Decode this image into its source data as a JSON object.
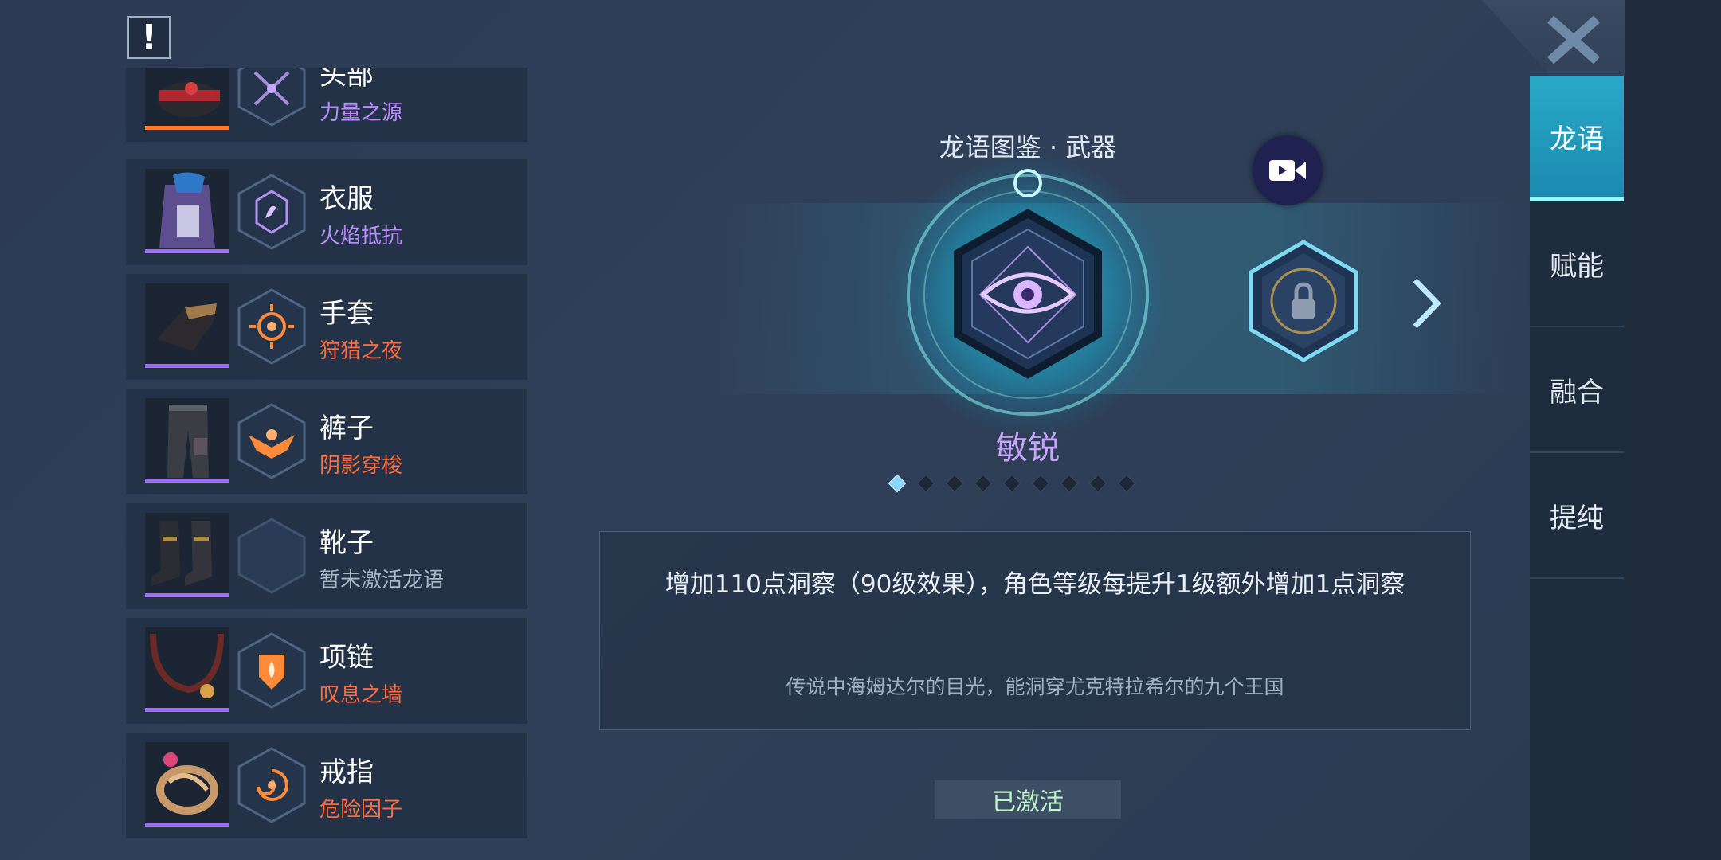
{
  "header": {
    "alert_icon": "!"
  },
  "equipment": [
    {
      "name": "头部",
      "sub": "力量之源",
      "sub_color": "#b98cff",
      "bar_color": "#ff7a2a",
      "icon": "crossed-swords-icon"
    },
    {
      "name": "衣服",
      "sub": "火焰抵抗",
      "sub_color": "#b98cff",
      "bar_color": "#9d6cff",
      "icon": "flame-sigil-icon"
    },
    {
      "name": "手套",
      "sub": "狩猎之夜",
      "sub_color": "#ff6b3d",
      "bar_color": "#9d6cff",
      "icon": "sun-moon-icon"
    },
    {
      "name": "裤子",
      "sub": "阴影穿梭",
      "sub_color": "#ff6b3d",
      "bar_color": "#9d6cff",
      "icon": "bat-wing-icon"
    },
    {
      "name": "靴子",
      "sub": "暂未激活龙语",
      "sub_color": "#a9b6c6",
      "bar_color": "#9d6cff",
      "icon": "empty-slot-icon"
    },
    {
      "name": "项链",
      "sub": "叹息之墙",
      "sub_color": "#ff6b3d",
      "bar_color": "#9d6cff",
      "icon": "shield-flame-icon"
    },
    {
      "name": "戒指",
      "sub": "危险因子",
      "sub_color": "#ff6b3d",
      "bar_color": "#9d6cff",
      "icon": "swirl-icon"
    }
  ],
  "codex": {
    "title": "龙语图鉴 · 武器",
    "skill_name": "敏锐",
    "emblem_icon": "eye-icon",
    "video_icon": "video-camera-icon",
    "locked_icon": "lock-icon",
    "next_icon": "chevron-right-icon",
    "page_count": 9,
    "active_page": 1
  },
  "description": {
    "effect": "增加110点洞察（90级效果），角色等级每提升1级额外增加1点洞察",
    "lore": "传说中海姆达尔的目光，能洞穿尤克特拉希尔的九个王国"
  },
  "status_button": "已激活",
  "tabs": [
    {
      "label": "龙语",
      "active": true
    },
    {
      "label": "赋能",
      "active": false
    },
    {
      "label": "融合",
      "active": false
    },
    {
      "label": "提纯",
      "active": false
    }
  ],
  "close_icon": "close-icon"
}
